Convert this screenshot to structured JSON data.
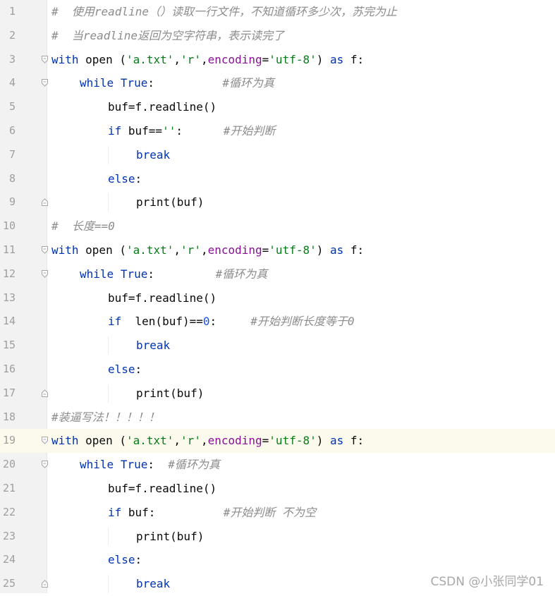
{
  "editor": {
    "lines": [
      {
        "num": "1",
        "indent": 0,
        "fold": "none",
        "tokens": [
          {
            "t": "cmt",
            "v": "#  使用readline（）读取一行文件，不知道循环多少次，苏完为止"
          }
        ]
      },
      {
        "num": "2",
        "indent": 0,
        "fold": "none",
        "tokens": [
          {
            "t": "cmt",
            "v": "#  当readline返回为空字符串，表示读完了"
          }
        ]
      },
      {
        "num": "3",
        "indent": 0,
        "fold": "open",
        "tokens": [
          {
            "t": "kw",
            "v": "with"
          },
          {
            "t": "txt",
            "v": " open ("
          },
          {
            "t": "str",
            "v": "'a.txt'"
          },
          {
            "t": "txt",
            "v": ","
          },
          {
            "t": "str",
            "v": "'r'"
          },
          {
            "t": "txt",
            "v": ","
          },
          {
            "t": "param",
            "v": "encoding"
          },
          {
            "t": "txt",
            "v": "="
          },
          {
            "t": "str",
            "v": "'utf-8'"
          },
          {
            "t": "txt",
            "v": ") "
          },
          {
            "t": "kw",
            "v": "as"
          },
          {
            "t": "txt",
            "v": " f:"
          }
        ]
      },
      {
        "num": "4",
        "indent": 1,
        "fold": "open",
        "tokens": [
          {
            "t": "kw",
            "v": "while"
          },
          {
            "t": "txt",
            "v": " "
          },
          {
            "t": "kw",
            "v": "True"
          },
          {
            "t": "txt",
            "v": ":          "
          },
          {
            "t": "cmt",
            "v": "#循环为真"
          }
        ]
      },
      {
        "num": "5",
        "indent": 2,
        "fold": "none",
        "tokens": [
          {
            "t": "txt",
            "v": "buf=f.readline()"
          }
        ]
      },
      {
        "num": "6",
        "indent": 2,
        "fold": "none",
        "tokens": [
          {
            "t": "kw",
            "v": "if"
          },
          {
            "t": "txt",
            "v": " buf=="
          },
          {
            "t": "str",
            "v": "''"
          },
          {
            "t": "txt",
            "v": ":      "
          },
          {
            "t": "cmt",
            "v": "#开始判断"
          }
        ]
      },
      {
        "num": "7",
        "indent": 3,
        "fold": "none",
        "tokens": [
          {
            "t": "kw",
            "v": "break"
          }
        ]
      },
      {
        "num": "8",
        "indent": 2,
        "fold": "none",
        "tokens": [
          {
            "t": "kw",
            "v": "else"
          },
          {
            "t": "txt",
            "v": ":"
          }
        ]
      },
      {
        "num": "9",
        "indent": 3,
        "fold": "close",
        "tokens": [
          {
            "t": "txt",
            "v": "print(buf)"
          }
        ]
      },
      {
        "num": "10",
        "indent": 0,
        "fold": "none",
        "tokens": [
          {
            "t": "cmt",
            "v": "#  长度==0"
          }
        ]
      },
      {
        "num": "11",
        "indent": 0,
        "fold": "open",
        "tokens": [
          {
            "t": "kw",
            "v": "with"
          },
          {
            "t": "txt",
            "v": " open ("
          },
          {
            "t": "str",
            "v": "'a.txt'"
          },
          {
            "t": "txt",
            "v": ","
          },
          {
            "t": "str",
            "v": "'r'"
          },
          {
            "t": "txt",
            "v": ","
          },
          {
            "t": "param",
            "v": "encoding"
          },
          {
            "t": "txt",
            "v": "="
          },
          {
            "t": "str",
            "v": "'utf-8'"
          },
          {
            "t": "txt",
            "v": ") "
          },
          {
            "t": "kw",
            "v": "as"
          },
          {
            "t": "txt",
            "v": " f:"
          }
        ]
      },
      {
        "num": "12",
        "indent": 1,
        "fold": "open",
        "tokens": [
          {
            "t": "kw",
            "v": "while"
          },
          {
            "t": "txt",
            "v": " "
          },
          {
            "t": "kw",
            "v": "True"
          },
          {
            "t": "txt",
            "v": ":         "
          },
          {
            "t": "cmt",
            "v": "#循环为真"
          }
        ]
      },
      {
        "num": "13",
        "indent": 2,
        "fold": "none",
        "tokens": [
          {
            "t": "txt",
            "v": "buf=f.readline()"
          }
        ]
      },
      {
        "num": "14",
        "indent": 2,
        "fold": "none",
        "tokens": [
          {
            "t": "kw",
            "v": "if"
          },
          {
            "t": "txt",
            "v": "  len(buf)=="
          },
          {
            "t": "num",
            "v": "0"
          },
          {
            "t": "txt",
            "v": ":     "
          },
          {
            "t": "cmt",
            "v": "#开始判断长度等于0"
          }
        ]
      },
      {
        "num": "15",
        "indent": 3,
        "fold": "none",
        "tokens": [
          {
            "t": "kw",
            "v": "break"
          }
        ]
      },
      {
        "num": "16",
        "indent": 2,
        "fold": "none",
        "tokens": [
          {
            "t": "kw",
            "v": "else"
          },
          {
            "t": "txt",
            "v": ":"
          }
        ]
      },
      {
        "num": "17",
        "indent": 3,
        "fold": "close",
        "tokens": [
          {
            "t": "txt",
            "v": "print(buf)"
          }
        ]
      },
      {
        "num": "18",
        "indent": 0,
        "fold": "none",
        "tokens": [
          {
            "t": "cmt",
            "v": "#装逼写法！！！！！"
          }
        ]
      },
      {
        "num": "19",
        "indent": 0,
        "fold": "open",
        "active": true,
        "tokens": [
          {
            "t": "kw",
            "v": "with"
          },
          {
            "t": "txt",
            "v": " open ("
          },
          {
            "t": "str",
            "v": "'a.txt'"
          },
          {
            "t": "txt",
            "v": ","
          },
          {
            "t": "str",
            "v": "'r'"
          },
          {
            "t": "txt",
            "v": ","
          },
          {
            "t": "param",
            "v": "encoding"
          },
          {
            "t": "txt",
            "v": "="
          },
          {
            "t": "str",
            "v": "'utf-8'"
          },
          {
            "t": "txt",
            "v": ") "
          },
          {
            "t": "kw",
            "v": "as"
          },
          {
            "t": "txt",
            "v": " f:"
          }
        ]
      },
      {
        "num": "20",
        "indent": 1,
        "fold": "open",
        "tokens": [
          {
            "t": "kw",
            "v": "while"
          },
          {
            "t": "txt",
            "v": " "
          },
          {
            "t": "kw",
            "v": "True"
          },
          {
            "t": "txt",
            "v": ":  "
          },
          {
            "t": "cmt",
            "v": "#循环为真"
          }
        ]
      },
      {
        "num": "21",
        "indent": 2,
        "fold": "none",
        "tokens": [
          {
            "t": "txt",
            "v": "buf=f.readline()"
          }
        ]
      },
      {
        "num": "22",
        "indent": 2,
        "fold": "none",
        "tokens": [
          {
            "t": "kw",
            "v": "if"
          },
          {
            "t": "txt",
            "v": " buf:          "
          },
          {
            "t": "cmt",
            "v": "#开始判断 不为空"
          }
        ]
      },
      {
        "num": "23",
        "indent": 3,
        "fold": "none",
        "tokens": [
          {
            "t": "txt",
            "v": "print(buf)"
          }
        ]
      },
      {
        "num": "24",
        "indent": 2,
        "fold": "none",
        "tokens": [
          {
            "t": "kw",
            "v": "else"
          },
          {
            "t": "txt",
            "v": ":"
          }
        ]
      },
      {
        "num": "25",
        "indent": 3,
        "fold": "close",
        "tokens": [
          {
            "t": "kw",
            "v": "break"
          }
        ]
      }
    ]
  },
  "watermark": "CSDN @小张同学01",
  "colors": {
    "keyword": "#0033b3",
    "string": "#067d17",
    "number": "#1750eb",
    "param": "#871094",
    "comment": "#8c8c8c",
    "active_line": "#fcfaed"
  }
}
